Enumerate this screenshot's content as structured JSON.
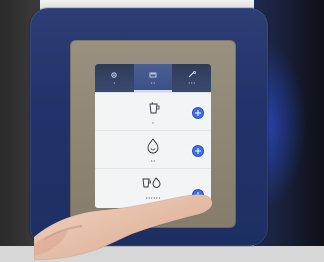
{
  "screen": {
    "tabs": [
      {
        "label": "•",
        "icon": "settings-icon"
      },
      {
        "label": "• •",
        "icon": "program-icon"
      },
      {
        "label": "• • •",
        "icon": "tools-icon"
      }
    ],
    "list": [
      {
        "label": "•",
        "icon": "cup-icon"
      },
      {
        "label": "• •",
        "icon": "drop-icon"
      },
      {
        "label": "• • • • • •",
        "icon": "double-icon"
      }
    ]
  },
  "colors": {
    "panel_blue": "#2c3e74",
    "bezel_gold": "#9a907f",
    "accent_blue": "#3b6ee8",
    "tabbar": "#394a71"
  }
}
